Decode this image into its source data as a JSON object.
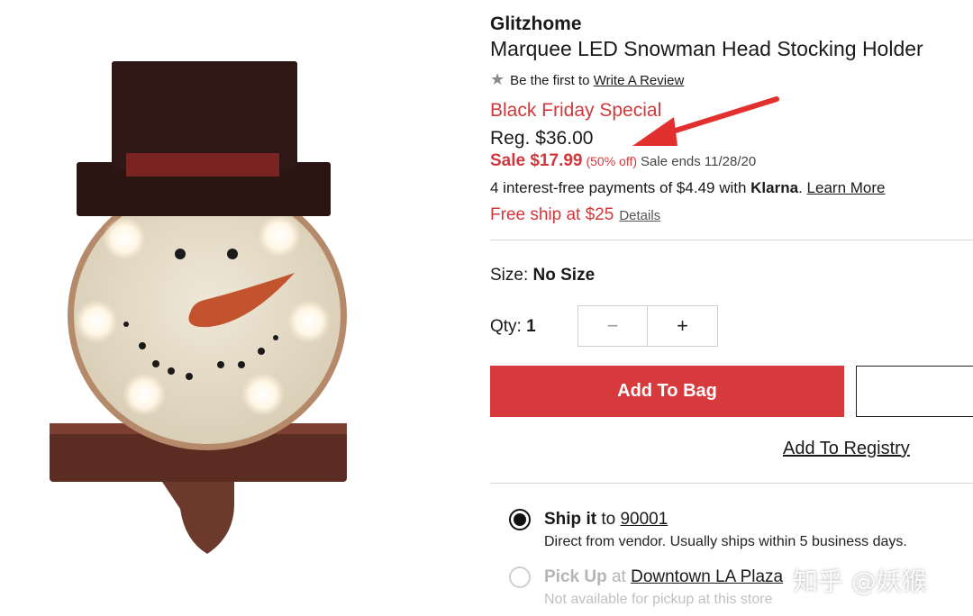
{
  "product": {
    "brand": "Glitzhome",
    "title": "Marquee LED Snowman Head Stocking Holder",
    "image_alt": "snowman-head-stocking-holder",
    "review": {
      "icon": "star-icon",
      "text": "Be the first to ",
      "link": "Write A Review"
    },
    "promo_label": "Black Friday Special",
    "regular_price": "Reg. $36.00",
    "sale_price": "Sale $17.99",
    "discount": "(50% off)",
    "sale_ends": "Sale ends 11/28/20",
    "klarna": {
      "prefix": "4 interest-free payments of $4.49 with ",
      "brand": "Klarna",
      "suffix": ".",
      "link": "Learn More"
    },
    "free_ship": {
      "text": "Free ship at $25",
      "link": "Details"
    }
  },
  "options": {
    "size_label": "Size: ",
    "size_value": "No Size",
    "qty_label": "Qty: ",
    "qty_value": "1",
    "minus": "−",
    "plus": "+"
  },
  "actions": {
    "add_to_bag": "Add To Bag",
    "add_to_registry": "Add To Registry"
  },
  "fulfillment": {
    "ship": {
      "strong": "Ship it",
      "to": " to ",
      "zip": "90001",
      "selected": true,
      "note": "Direct from vendor. Usually ships within 5 business days."
    },
    "pickup": {
      "strong": "Pick Up",
      "at": " at ",
      "store": "Downtown LA Plaza",
      "selected": false,
      "note": "Not available for pickup at this store"
    }
  },
  "watermark": "知乎 @妖猴",
  "colors": {
    "accent_red": "#d63a3d",
    "text_dark": "#1a1a1a",
    "divider": "#d6d6d6"
  }
}
